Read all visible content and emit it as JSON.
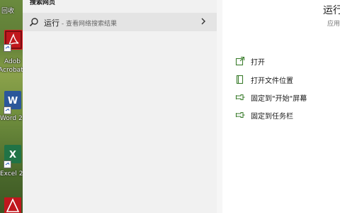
{
  "desktop": {
    "recycle_bin_label": "回收",
    "icons": [
      {
        "label_line1": "Adob",
        "label_line2": "Acrobat"
      },
      {
        "label": "Word 2"
      },
      {
        "label": "Excel 2"
      }
    ]
  },
  "search": {
    "section_title": "搜索网页",
    "result_main": "运行",
    "result_sub": " - 查看网络搜索结果"
  },
  "app_panel": {
    "title": "运行",
    "subtitle": "应用",
    "actions": [
      {
        "label": "打开",
        "icon": "open-icon"
      },
      {
        "label": "打开文件位置",
        "icon": "file-location-icon"
      },
      {
        "label": "固定到\"开始\"屏幕",
        "icon": "pin-icon"
      },
      {
        "label": "固定到任务栏",
        "icon": "pin-icon"
      }
    ]
  },
  "colors": {
    "accent": "#3c7e2f",
    "adobe_red": "#c0171d",
    "word_blue": "#2b579a",
    "excel_green": "#217346"
  }
}
